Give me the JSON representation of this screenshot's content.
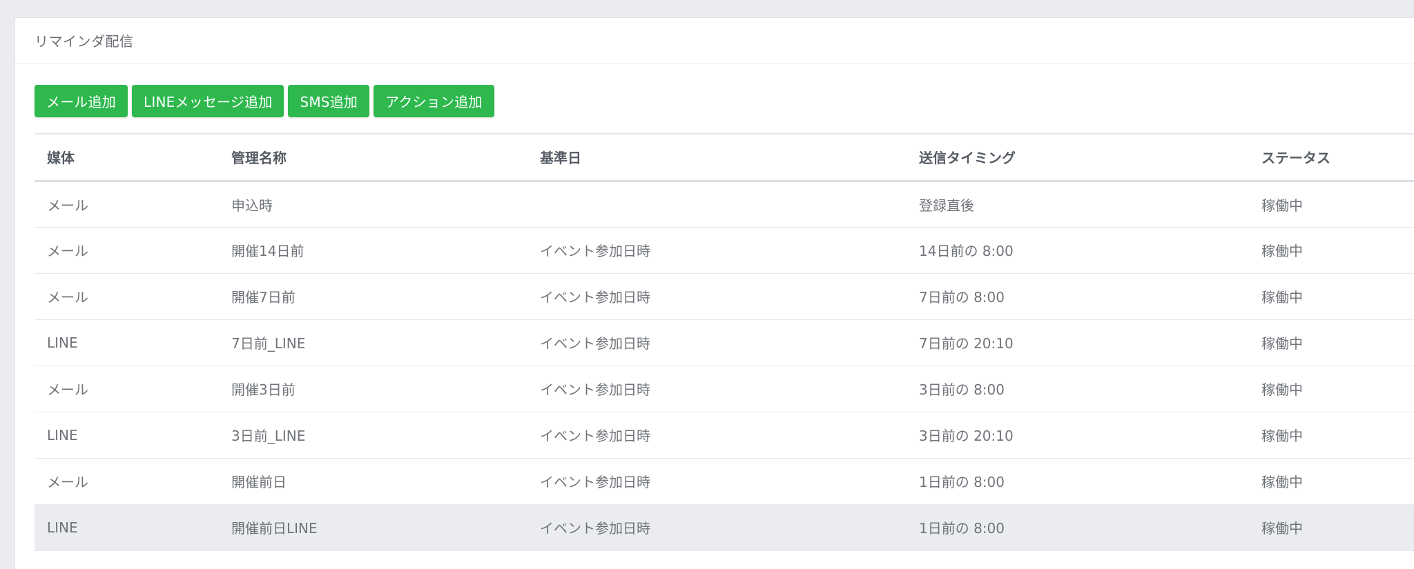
{
  "panel": {
    "title": "リマインダ配信"
  },
  "toolbar": {
    "buttons": [
      {
        "label": "メール追加"
      },
      {
        "label": "LINEメッセージ追加"
      },
      {
        "label": "SMS追加"
      },
      {
        "label": "アクション追加"
      }
    ]
  },
  "table": {
    "headers": [
      "媒体",
      "管理名称",
      "基準日",
      "送信タイミング",
      "ステータス"
    ],
    "rows": [
      {
        "media": "メール",
        "name": "申込時",
        "base_date": "",
        "timing": "登録直後",
        "status": "稼働中"
      },
      {
        "media": "メール",
        "name": "開催14日前",
        "base_date": "イベント参加日時",
        "timing": "14日前の 8:00",
        "status": "稼働中"
      },
      {
        "media": "メール",
        "name": "開催7日前",
        "base_date": "イベント参加日時",
        "timing": "7日前の 8:00",
        "status": "稼働中"
      },
      {
        "media": "LINE",
        "name": "7日前_LINE",
        "base_date": "イベント参加日時",
        "timing": "7日前の 20:10",
        "status": "稼働中"
      },
      {
        "media": "メール",
        "name": "開催3日前",
        "base_date": "イベント参加日時",
        "timing": "3日前の 8:00",
        "status": "稼働中"
      },
      {
        "media": "LINE",
        "name": "3日前_LINE",
        "base_date": "イベント参加日時",
        "timing": "3日前の 20:10",
        "status": "稼働中"
      },
      {
        "media": "メール",
        "name": "開催前日",
        "base_date": "イベント参加日時",
        "timing": "1日前の 8:00",
        "status": "稼働中"
      },
      {
        "media": "LINE",
        "name": "開催前日LINE",
        "base_date": "イベント参加日時",
        "timing": "1日前の 8:00",
        "status": "稼働中"
      }
    ]
  },
  "colors": {
    "accent": "#2eb84e",
    "background": "#ebecef",
    "panel": "#ffffff",
    "row_hover": "#ebecef"
  }
}
